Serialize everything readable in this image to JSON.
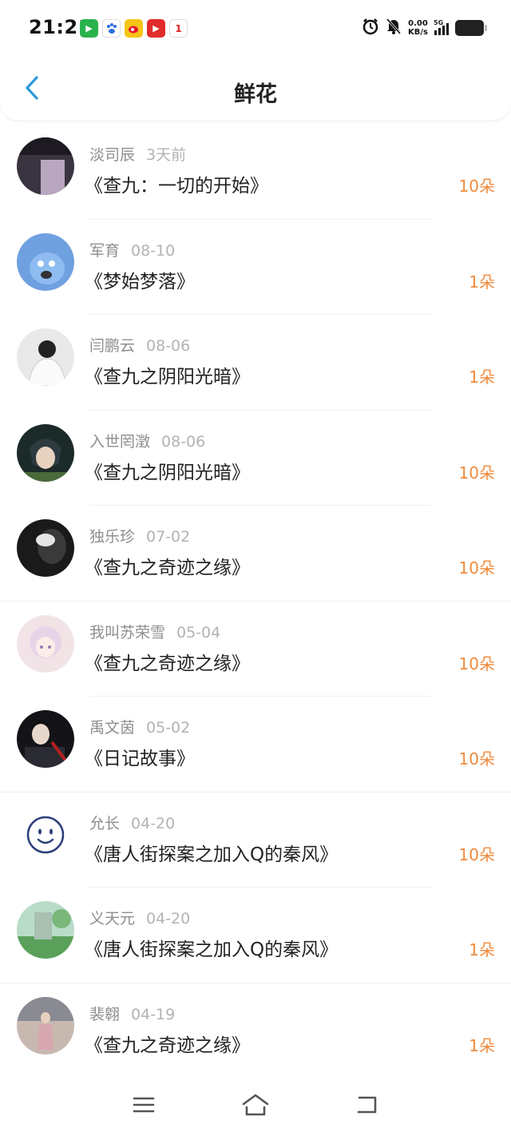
{
  "status": {
    "time": "21:21",
    "net_speed_value": "0.00",
    "net_speed_unit": "KB/s",
    "network": "5G",
    "notif_badge": "1"
  },
  "header": {
    "title": "鲜花"
  },
  "colors": {
    "accent_blue": "#2b9bdc",
    "flower_orange": "#f08a3c"
  },
  "items": [
    {
      "name": "淡司辰",
      "date": "3天前",
      "title": "《查九：一切的开始》",
      "flowers": "10朵"
    },
    {
      "name": "军育",
      "date": "08-10",
      "title": "《梦始梦落》",
      "flowers": "1朵"
    },
    {
      "name": "闫鹏云",
      "date": "08-06",
      "title": "《查九之阴阳光暗》",
      "flowers": "1朵"
    },
    {
      "name": "入世罔澂",
      "date": "08-06",
      "title": "《查九之阴阳光暗》",
      "flowers": "10朵"
    },
    {
      "name": "独乐珍",
      "date": "07-02",
      "title": "《查九之奇迹之缘》",
      "flowers": "10朵"
    },
    {
      "name": "我叫苏荣雪",
      "date": "05-04",
      "title": "《查九之奇迹之缘》",
      "flowers": "10朵"
    },
    {
      "name": "禹文茵",
      "date": "05-02",
      "title": "《日记故事》",
      "flowers": "10朵"
    },
    {
      "name": "允长",
      "date": "04-20",
      "title": "《唐人街探案之加入Q的秦风》",
      "flowers": "10朵"
    },
    {
      "name": "义天元",
      "date": "04-20",
      "title": "《唐人街探案之加入Q的秦风》",
      "flowers": "1朵"
    },
    {
      "name": "裴翱",
      "date": "04-19",
      "title": "《查九之奇迹之缘》",
      "flowers": "1朵"
    }
  ]
}
